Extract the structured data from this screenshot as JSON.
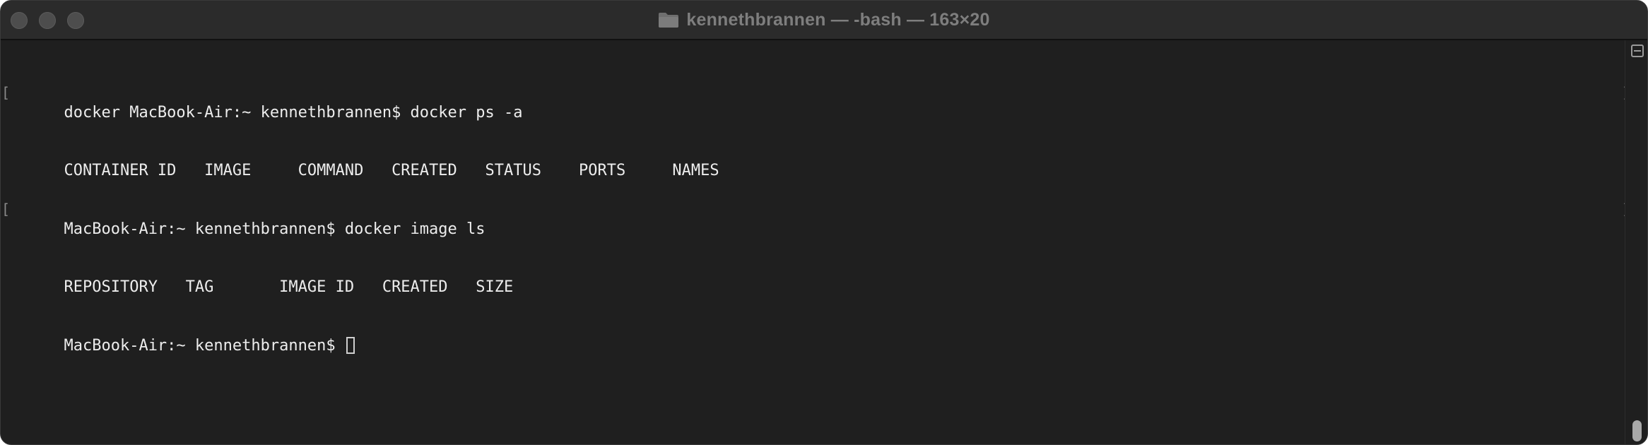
{
  "window": {
    "title": "kennethbrannen — -bash — 163×20",
    "title_icon": "folder-icon"
  },
  "terminal": {
    "lines": [
      {
        "text": "docker MacBook-Air:~ kennethbrannen$ docker ps -a",
        "marked": true
      },
      {
        "text": "CONTAINER ID   IMAGE     COMMAND   CREATED   STATUS    PORTS     NAMES",
        "marked": false
      },
      {
        "text": "MacBook-Air:~ kennethbrannen$ docker image ls",
        "marked": true
      },
      {
        "text": "REPOSITORY   TAG       IMAGE ID   CREATED   SIZE",
        "marked": false
      },
      {
        "text": "MacBook-Air:~ kennethbrannen$ ",
        "marked": false,
        "cursor": true
      }
    ],
    "mark_left": "[",
    "mark_right": "]"
  },
  "colors": {
    "background": "#1f1f1f",
    "titlebar": "#2b2b2b",
    "text": "#ededed",
    "title_text": "#7e7e7e"
  },
  "scrollbar": {
    "split_icon": "split-pane-icon"
  }
}
